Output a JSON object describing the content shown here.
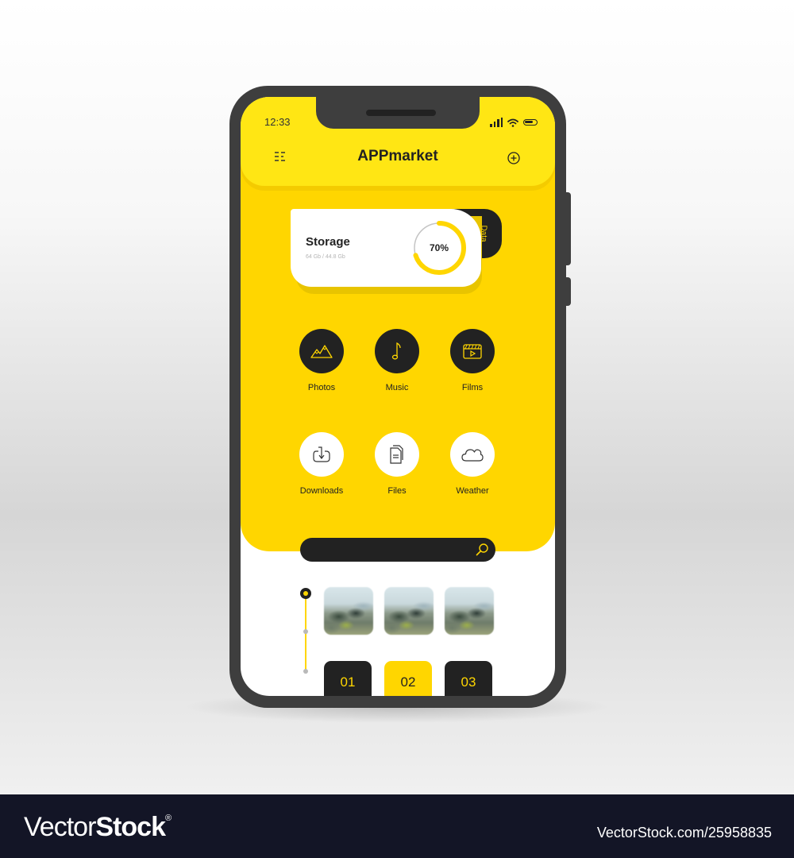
{
  "status_bar": {
    "time": "12:33",
    "icons": [
      "signal-icon",
      "wifi-icon",
      "battery-icon"
    ]
  },
  "header": {
    "title": "APPmarket",
    "menu_icon": "menu-icon",
    "add_icon": "plus-circle-icon"
  },
  "storage": {
    "title": "Storage",
    "subtitle": "64 Gb / 44.8 Gb",
    "percent_label": "70%",
    "percent_value": 0.7,
    "tab_label": "Data"
  },
  "apps": [
    {
      "label": "Photos",
      "icon": "mountains-icon",
      "style": "dark"
    },
    {
      "label": "Music",
      "icon": "music-note-icon",
      "style": "dark"
    },
    {
      "label": "Films",
      "icon": "clapperboard-icon",
      "style": "dark"
    },
    {
      "label": "Downloads",
      "icon": "download-icon",
      "style": "light"
    },
    {
      "label": "Files",
      "icon": "document-icon",
      "style": "light"
    },
    {
      "label": "Weather",
      "icon": "cloud-icon",
      "style": "light"
    }
  ],
  "search": {
    "placeholder": "",
    "icon": "search-icon"
  },
  "gallery": {
    "timeline_steps": 3,
    "active_step": 1,
    "thumbnails": [
      "city-photo-1",
      "city-photo-2",
      "city-photo-3"
    ],
    "pages": [
      {
        "label": "01",
        "active": false
      },
      {
        "label": "02",
        "active": true
      },
      {
        "label": "03",
        "active": false
      }
    ]
  },
  "colors": {
    "accent": "#ffd600",
    "header_yellow": "#ffe614",
    "dark": "#222222",
    "phone_frame": "#3e3e3e"
  },
  "footer": {
    "logo_light": "Vector",
    "logo_bold": "Stock",
    "logo_mark": "®",
    "image_id": "VectorStock.com/25958835"
  }
}
